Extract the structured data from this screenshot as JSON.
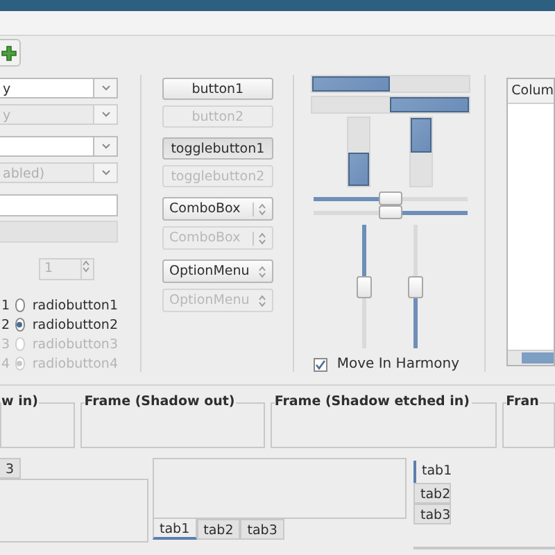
{
  "combos": [
    {
      "value": "y",
      "disabled": false
    },
    {
      "value": "y",
      "disabled": true
    },
    {
      "disabled": false
    },
    {
      "value": "abled)",
      "disabled": true
    }
  ],
  "entries": [
    {
      "disabled": false
    },
    {
      "disabled": true
    }
  ],
  "spin": {
    "value": "1",
    "disabled": true
  },
  "radio_rows": [
    {
      "cut_label": "1",
      "label": "radiobutton1",
      "selected": false,
      "disabled": false
    },
    {
      "cut_label": "2",
      "label": "radiobutton2",
      "selected": true,
      "disabled": false
    },
    {
      "cut_label": "3",
      "label": "radiobutton3",
      "selected": false,
      "disabled": true
    },
    {
      "cut_label": "4",
      "label": "radiobutton4",
      "selected": true,
      "disabled": true
    }
  ],
  "buttons": [
    {
      "kind": "push",
      "label": "button1",
      "disabled": false
    },
    {
      "kind": "push",
      "label": "button2",
      "disabled": true
    },
    {
      "kind": "toggle",
      "label": "togglebutton1",
      "disabled": false,
      "pressed": true
    },
    {
      "kind": "toggle",
      "label": "togglebutton2",
      "disabled": true,
      "pressed": false
    },
    {
      "kind": "combo",
      "label": "ComboBox",
      "disabled": false
    },
    {
      "kind": "combo",
      "label": "ComboBox",
      "disabled": true
    },
    {
      "kind": "option",
      "label": "OptionMenu",
      "disabled": false
    },
    {
      "kind": "option",
      "label": "OptionMenu",
      "disabled": true
    }
  ],
  "progress_bars": [
    {
      "kind": "horizontal",
      "level": 0.5,
      "from_end": false
    },
    {
      "kind": "horizontal",
      "level": 0.5,
      "from_end": true
    },
    {
      "kind": "vertical",
      "level": 0.5,
      "from_end": true
    },
    {
      "kind": "vertical",
      "level": 0.5,
      "from_end": false
    }
  ],
  "horizontal_scales": [
    {
      "level": 0.5,
      "inverted": false
    },
    {
      "level": 0.5,
      "inverted": true
    }
  ],
  "vertical_scales": [
    {
      "level": 0.5,
      "inverted": false
    },
    {
      "level": 0.5,
      "inverted": true
    }
  ],
  "harmony": {
    "label": "Move In Harmony",
    "checked": true
  },
  "tree": {
    "columns": [
      "Colum"
    ]
  },
  "frames": [
    {
      "label": "w in)"
    },
    {
      "label": "Frame (Shadow out)"
    },
    {
      "label": "Frame (Shadow etched in)"
    },
    {
      "label": "Fran"
    }
  ],
  "notebooks": [
    {
      "kind": "top",
      "tabs": [
        {
          "label": "3",
          "selected": false
        }
      ]
    },
    {
      "kind": "bottom",
      "tabs": [
        {
          "label": "tab1",
          "selected": true
        },
        {
          "label": "tab2",
          "selected": false
        },
        {
          "label": "tab3",
          "selected": false
        }
      ]
    },
    {
      "kind": "left",
      "tabs": [
        {
          "label": "tab1",
          "selected": true
        },
        {
          "label": "tab2",
          "selected": false
        },
        {
          "label": "tab3",
          "selected": false
        }
      ]
    }
  ]
}
